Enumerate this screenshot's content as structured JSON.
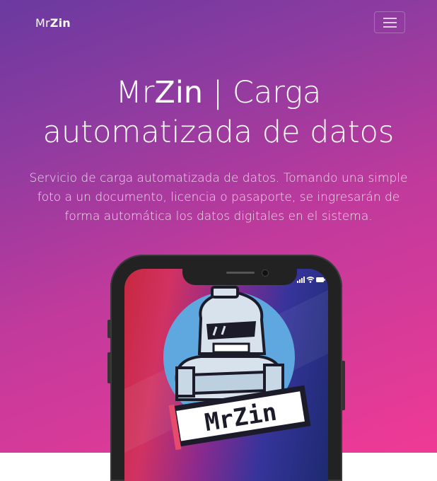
{
  "navbar": {
    "brand_prefix": "Mr",
    "brand_suffix": "Zin",
    "toggle_icon": "hamburger-icon"
  },
  "hero": {
    "title_mr": "Mr",
    "title_zin": "Zin",
    "title_sep": "|",
    "title_rest_line1": "Carga",
    "title_line2": "automatizada de datos",
    "subtitle": "Servicio de carga automatizada de datos. Tomando una simple foto a un documento, licencia o pasaporte, se ingresarán de forma automática los datos digitales en el sistema."
  },
  "phone": {
    "logo_text": "MrZin",
    "status_icons": [
      "signal-icon",
      "wifi-icon",
      "battery-icon"
    ]
  },
  "colors": {
    "gradient_start": "#6a3aa0",
    "gradient_end": "#ef3a95",
    "text": "#ffffff"
  }
}
